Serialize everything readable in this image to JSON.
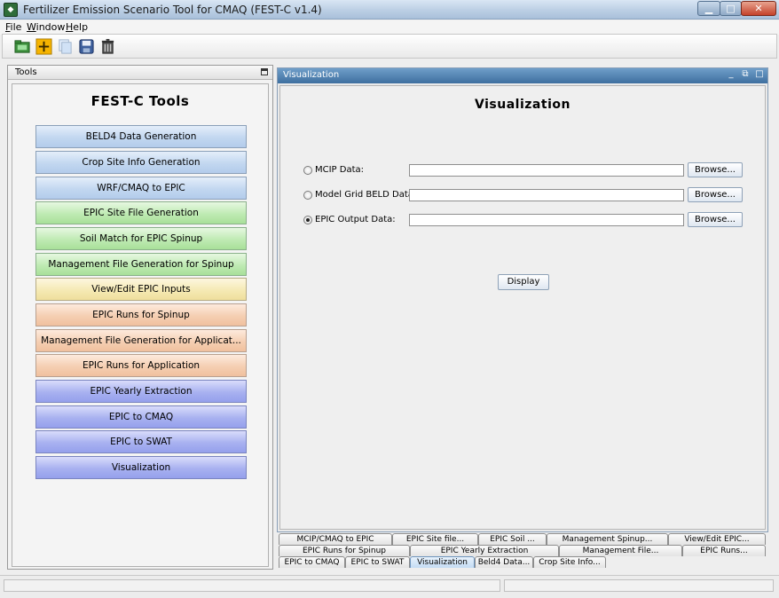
{
  "window": {
    "title": "Fertilizer Emission Scenario Tool for CMAQ (FEST-C v1.4)",
    "minimize_glyph": "▁",
    "maximize_glyph": "□",
    "close_glyph": "✕"
  },
  "menu": [
    "File",
    "Window",
    "Help"
  ],
  "toolbar": {
    "icons": [
      "open-folder-icon",
      "add-icon",
      "copy-icon",
      "save-disk-icon",
      "trash-icon"
    ]
  },
  "tools_panel": {
    "header": "Tools",
    "title": "FEST-C Tools",
    "buttons": [
      {
        "label": "BELD4 Data Generation",
        "group": "blue"
      },
      {
        "label": "Crop Site Info Generation",
        "group": "blue"
      },
      {
        "label": "WRF/CMAQ to EPIC",
        "group": "blue"
      },
      {
        "label": "EPIC Site File Generation",
        "group": "green"
      },
      {
        "label": "Soil Match for EPIC Spinup",
        "group": "green"
      },
      {
        "label": "Management File Generation for Spinup",
        "group": "green"
      },
      {
        "label": "View/Edit EPIC Inputs",
        "group": "yellow"
      },
      {
        "label": "EPIC Runs for Spinup",
        "group": "peach"
      },
      {
        "label": "Management File Generation for Applicat...",
        "group": "peach"
      },
      {
        "label": "EPIC Runs for Application",
        "group": "peach"
      },
      {
        "label": "EPIC Yearly Extraction",
        "group": "violet"
      },
      {
        "label": "EPIC to CMAQ",
        "group": "violet"
      },
      {
        "label": "EPIC to SWAT",
        "group": "violet"
      },
      {
        "label": "Visualization",
        "group": "violet"
      }
    ]
  },
  "visualization": {
    "frame_title": "Visualization",
    "heading": "Visualization",
    "rows": [
      {
        "label": "MCIP Data:",
        "value": "",
        "checked": false,
        "browse": "Browse..."
      },
      {
        "label": "Model Grid BELD Data:",
        "value": "",
        "checked": false,
        "browse": "Browse..."
      },
      {
        "label": "EPIC Output Data:",
        "value": "",
        "checked": true,
        "browse": "Browse..."
      }
    ],
    "display_button": "Display"
  },
  "tabs": {
    "row1": [
      "MCIP/CMAQ to EPIC",
      "EPIC Site file...",
      "EPIC Soil ...",
      "Management Spinup...",
      "View/Edit EPIC..."
    ],
    "row2": [
      "EPIC Runs for Spinup",
      "EPIC Yearly Extraction",
      "Management File...",
      "EPIC Runs..."
    ],
    "row3": [
      "EPIC to CMAQ",
      "EPIC to SWAT",
      "Visualization",
      "Beld4 Data...",
      "Crop Site Info..."
    ],
    "selected": "Visualization"
  },
  "colors": {
    "tool_blue": "#c2d7f0",
    "tool_green": "#bfeab3",
    "tool_yellow": "#f5e9b4",
    "tool_peach": "#f5cfb2",
    "tool_violet": "#a8b1f0",
    "frame_title": "#3e6f9f"
  }
}
